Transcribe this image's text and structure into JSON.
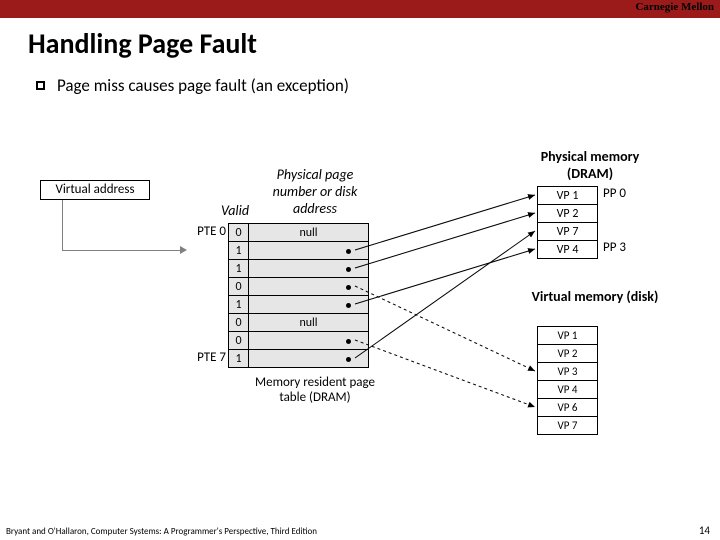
{
  "header": {
    "org": "Carnegie Mellon"
  },
  "title": "Handling Page Fault",
  "bullet": "Page miss causes page fault (an exception)",
  "labels": {
    "virtual_address": "Virtual address",
    "valid": "Valid",
    "phys_header": "Physical page number or disk address",
    "pte0": "PTE 0",
    "pte7": "PTE 7",
    "phys_mem": "Physical memory (DRAM)",
    "virt_mem": "Virtual memory (disk)",
    "mem_resident": "Memory resident page table (DRAM)"
  },
  "pte": [
    {
      "valid": "0",
      "addr": "null"
    },
    {
      "valid": "1",
      "addr": ""
    },
    {
      "valid": "1",
      "addr": ""
    },
    {
      "valid": "0",
      "addr": ""
    },
    {
      "valid": "1",
      "addr": ""
    },
    {
      "valid": "0",
      "addr": "null"
    },
    {
      "valid": "0",
      "addr": ""
    },
    {
      "valid": "1",
      "addr": ""
    }
  ],
  "pm": [
    "VP 1",
    "VP 2",
    "VP 7",
    "VP 4"
  ],
  "pp_labels": [
    "PP 0",
    "PP 3"
  ],
  "vm": [
    "VP 1",
    "VP 2",
    "VP 3",
    "VP 4",
    "VP 6",
    "VP 7"
  ],
  "footer": "Bryant and O'Hallaron, Computer Systems: A Programmer's Perspective, Third Edition",
  "page": "14"
}
